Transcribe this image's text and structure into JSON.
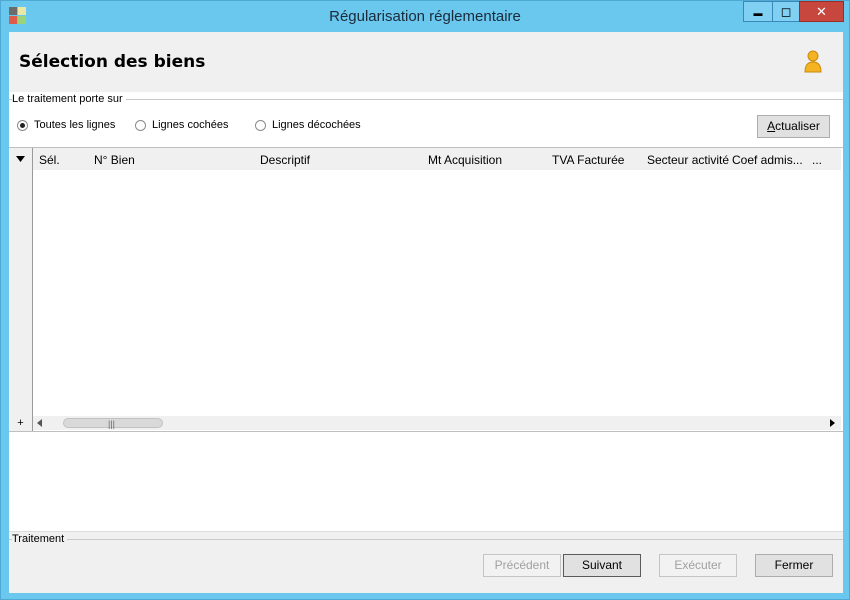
{
  "window": {
    "title": "Régularisation réglementaire",
    "minimize_label": "▬",
    "maximize_label": "◻",
    "close_label": "✕",
    "icon": "app-icon",
    "colors": {
      "frame": "#6ac7ee",
      "close": "#c7463e"
    }
  },
  "header": {
    "title": "Sélection des biens",
    "user_icon": "user-icon"
  },
  "scope": {
    "group_label": "Le traitement porte sur",
    "options": [
      {
        "label": "Toutes les lignes",
        "checked": true
      },
      {
        "label": "Lignes cochées",
        "checked": false
      },
      {
        "label": "Lignes décochées",
        "checked": false
      }
    ],
    "refresh_label": "Actualiser"
  },
  "grid": {
    "columns": [
      "Sél.",
      "N° Bien",
      "Descriptif",
      "Mt Acquisition",
      "TVA Facturée",
      "Secteur activité",
      "Coef admis...",
      "..."
    ],
    "expand_label": "+",
    "rows": []
  },
  "footer": {
    "group_label": "Traitement",
    "buttons": {
      "previous": "Précédent",
      "next": "Suivant",
      "execute": "Exécuter",
      "close": "Fermer"
    }
  }
}
